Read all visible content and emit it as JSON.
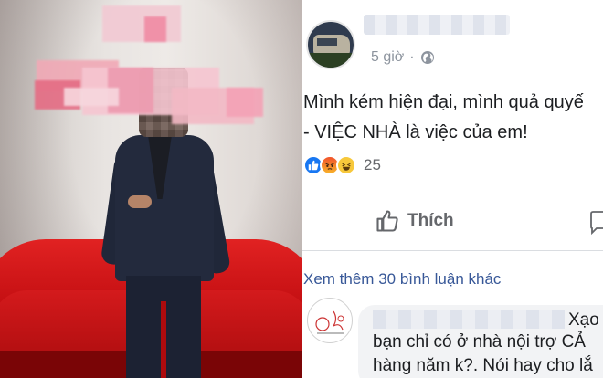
{
  "post": {
    "time": "5 giờ",
    "separator": "·",
    "text_line1": "Mình kém hiện đại, mình quả quyế",
    "text_line2": "- VIỆC NHÀ là việc của em!",
    "reaction_count": "25",
    "like_label": "Thích"
  },
  "comments": {
    "see_more": "Xem thêm 30 bình luận khác",
    "first": {
      "line1": "Xạo",
      "line2": "bạn chỉ có ở nhà nội trợ CẢ",
      "line3": "hàng năm k?. Nói hay cho lắ"
    }
  },
  "colors": {
    "link": "#385898",
    "meta": "#8d949e",
    "like_blue": "#1877f2",
    "sofa_red": "#c40f12"
  },
  "icons": {
    "globe": "globe-icon",
    "thumbs_up": "thumbs-up-icon",
    "comment": "comment-icon"
  }
}
